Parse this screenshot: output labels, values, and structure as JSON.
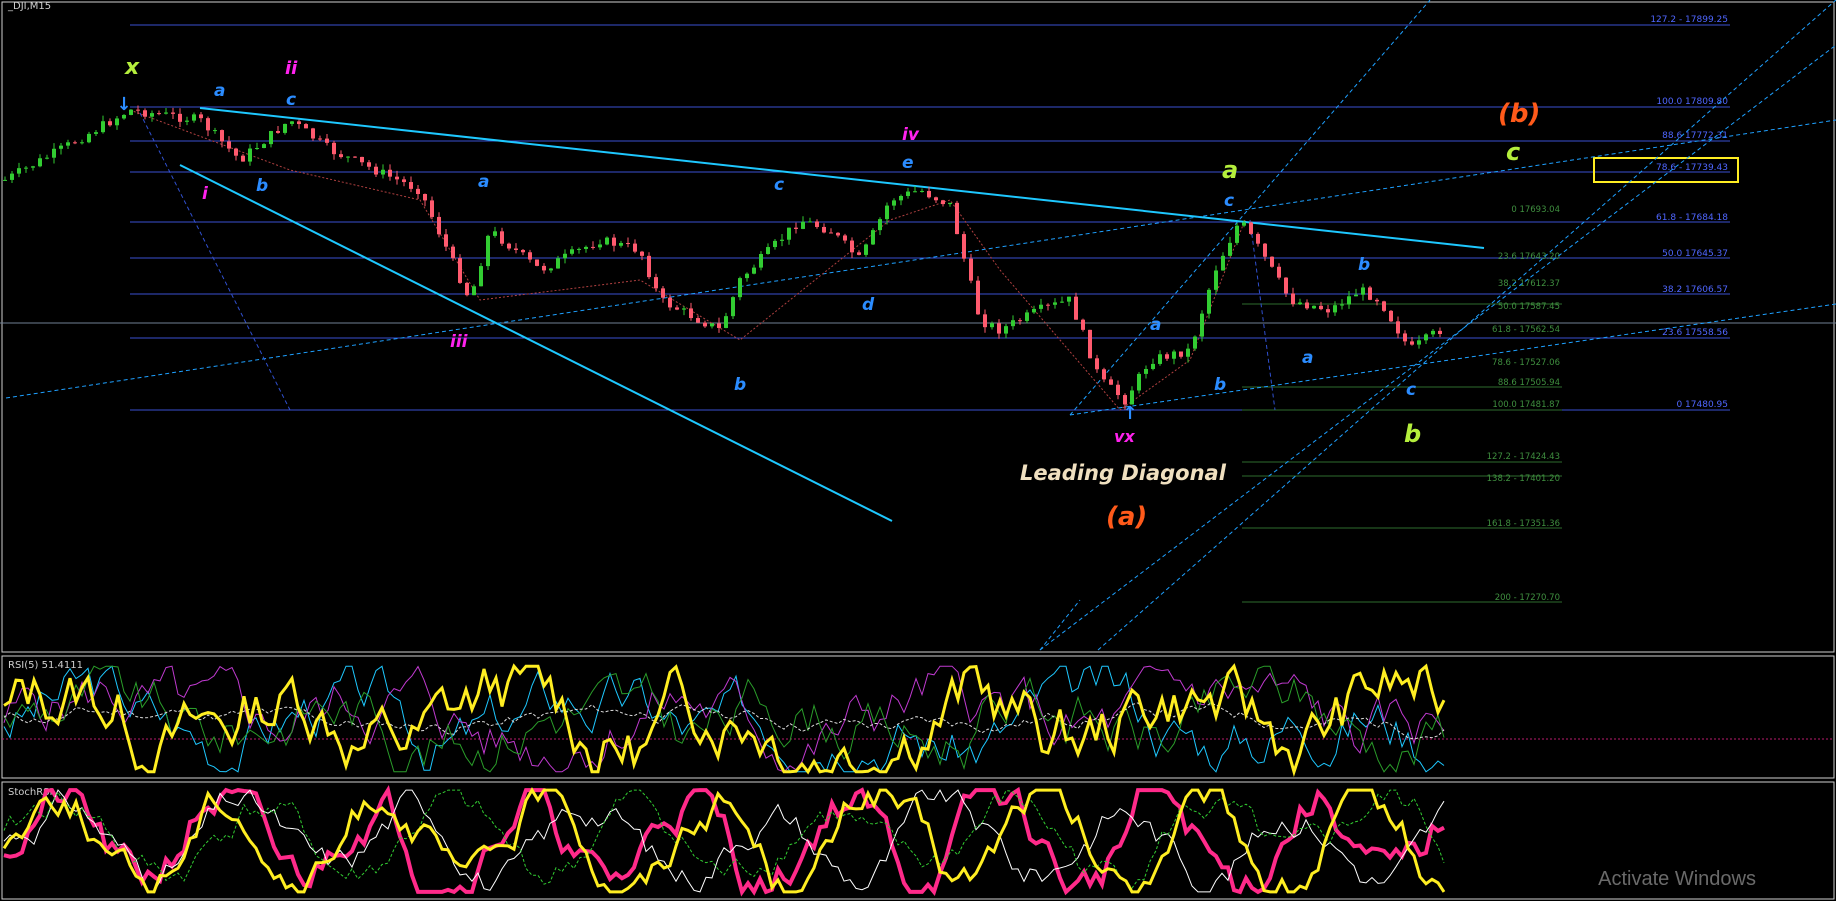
{
  "window": {
    "symbol_label": "_DJI,M15"
  },
  "colors": {
    "bull": "#32cd32",
    "bear": "#ff5a6e",
    "fib": "#3a4fd0",
    "fib_text": "#4f66ff",
    "trend": "#1ec8ff",
    "yellow": "#ffee22",
    "magenta": "#ff22ee",
    "wave_blue": "#2b8cff",
    "wave_green": "#b4ee3c",
    "orange": "#ff5a1a"
  },
  "fib_right": [
    "127.2 - 17899.25",
    "100.0 17809.80",
    "88.6 17772.31",
    "78.6 - 17739.43",
    "61.8 - 17684.18",
    "50.0 17645.37",
    "38.2 17606.57",
    "23.6 17558.56",
    "0 17480.95"
  ],
  "fib_mid": [
    "0 17693.04",
    "23.6 17643.20",
    "38.2 17612.37",
    "50.0 17587.45",
    "61.8 - 17562.54",
    "78.6 - 17527.06",
    "88.6 17505.94",
    "100.0 17481.87",
    "127.2 - 17424.43",
    "138.2 - 17401.20",
    "161.8 - 17351.36",
    "200 - 17270.70"
  ],
  "wave_labels": {
    "x": "x",
    "ii": "ii",
    "a": "a",
    "b": "b",
    "c": "c",
    "d": "d",
    "e": "e",
    "i": "i",
    "iii": "iii",
    "iv": "iv",
    "vx": "vx",
    "paren_b": "(b)",
    "paren_a": "(a)"
  },
  "annotation": "Leading Diagonal",
  "indicators": {
    "rsi_label": "RSI(5) 51.4111",
    "stoch_label": "StochRSI"
  },
  "watermark": "Activate Windows"
}
